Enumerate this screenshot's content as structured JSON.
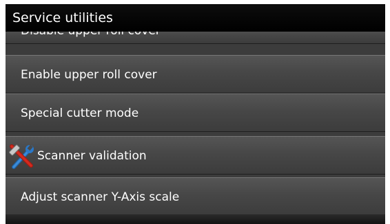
{
  "header": {
    "title": "Service utilities"
  },
  "menu": {
    "items": [
      {
        "label": "Disable upper roll cover",
        "icon": null
      },
      {
        "label": "Enable upper roll cover",
        "icon": null
      },
      {
        "label": "Special cutter mode",
        "icon": null
      },
      {
        "label": "Scanner validation",
        "icon": "hammer-wrench-tools-icon"
      },
      {
        "label": "Adjust scanner Y-Axis scale",
        "icon": null
      }
    ]
  },
  "colors": {
    "header_bg": "#000000",
    "item_bg": "#4a4a4a",
    "text": "#ffffff",
    "tool_icon_red": "#d42a1e",
    "tool_icon_blue": "#2a78c8"
  }
}
